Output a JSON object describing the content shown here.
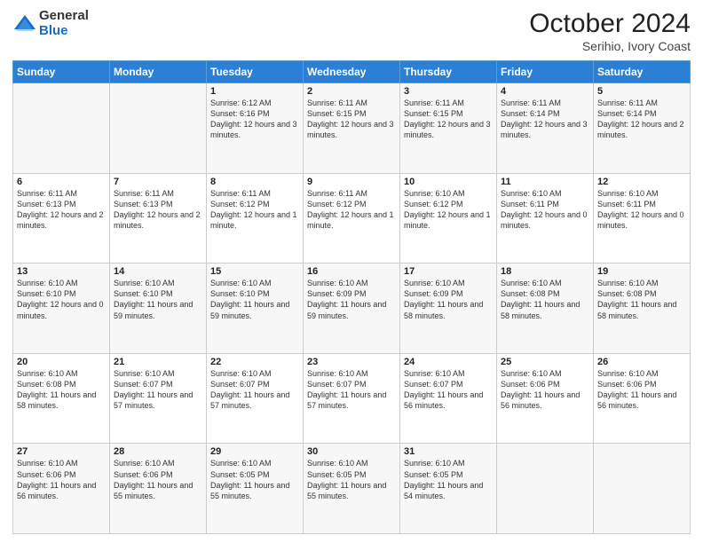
{
  "logo": {
    "general": "General",
    "blue": "Blue"
  },
  "title": "October 2024",
  "location": "Serihio, Ivory Coast",
  "days_of_week": [
    "Sunday",
    "Monday",
    "Tuesday",
    "Wednesday",
    "Thursday",
    "Friday",
    "Saturday"
  ],
  "weeks": [
    [
      {
        "day": "",
        "info": ""
      },
      {
        "day": "",
        "info": ""
      },
      {
        "day": "1",
        "info": "Sunrise: 6:12 AM\nSunset: 6:16 PM\nDaylight: 12 hours and 3 minutes."
      },
      {
        "day": "2",
        "info": "Sunrise: 6:11 AM\nSunset: 6:15 PM\nDaylight: 12 hours and 3 minutes."
      },
      {
        "day": "3",
        "info": "Sunrise: 6:11 AM\nSunset: 6:15 PM\nDaylight: 12 hours and 3 minutes."
      },
      {
        "day": "4",
        "info": "Sunrise: 6:11 AM\nSunset: 6:14 PM\nDaylight: 12 hours and 3 minutes."
      },
      {
        "day": "5",
        "info": "Sunrise: 6:11 AM\nSunset: 6:14 PM\nDaylight: 12 hours and 2 minutes."
      }
    ],
    [
      {
        "day": "6",
        "info": "Sunrise: 6:11 AM\nSunset: 6:13 PM\nDaylight: 12 hours and 2 minutes."
      },
      {
        "day": "7",
        "info": "Sunrise: 6:11 AM\nSunset: 6:13 PM\nDaylight: 12 hours and 2 minutes."
      },
      {
        "day": "8",
        "info": "Sunrise: 6:11 AM\nSunset: 6:12 PM\nDaylight: 12 hours and 1 minute."
      },
      {
        "day": "9",
        "info": "Sunrise: 6:11 AM\nSunset: 6:12 PM\nDaylight: 12 hours and 1 minute."
      },
      {
        "day": "10",
        "info": "Sunrise: 6:10 AM\nSunset: 6:12 PM\nDaylight: 12 hours and 1 minute."
      },
      {
        "day": "11",
        "info": "Sunrise: 6:10 AM\nSunset: 6:11 PM\nDaylight: 12 hours and 0 minutes."
      },
      {
        "day": "12",
        "info": "Sunrise: 6:10 AM\nSunset: 6:11 PM\nDaylight: 12 hours and 0 minutes."
      }
    ],
    [
      {
        "day": "13",
        "info": "Sunrise: 6:10 AM\nSunset: 6:10 PM\nDaylight: 12 hours and 0 minutes."
      },
      {
        "day": "14",
        "info": "Sunrise: 6:10 AM\nSunset: 6:10 PM\nDaylight: 11 hours and 59 minutes."
      },
      {
        "day": "15",
        "info": "Sunrise: 6:10 AM\nSunset: 6:10 PM\nDaylight: 11 hours and 59 minutes."
      },
      {
        "day": "16",
        "info": "Sunrise: 6:10 AM\nSunset: 6:09 PM\nDaylight: 11 hours and 59 minutes."
      },
      {
        "day": "17",
        "info": "Sunrise: 6:10 AM\nSunset: 6:09 PM\nDaylight: 11 hours and 58 minutes."
      },
      {
        "day": "18",
        "info": "Sunrise: 6:10 AM\nSunset: 6:08 PM\nDaylight: 11 hours and 58 minutes."
      },
      {
        "day": "19",
        "info": "Sunrise: 6:10 AM\nSunset: 6:08 PM\nDaylight: 11 hours and 58 minutes."
      }
    ],
    [
      {
        "day": "20",
        "info": "Sunrise: 6:10 AM\nSunset: 6:08 PM\nDaylight: 11 hours and 58 minutes."
      },
      {
        "day": "21",
        "info": "Sunrise: 6:10 AM\nSunset: 6:07 PM\nDaylight: 11 hours and 57 minutes."
      },
      {
        "day": "22",
        "info": "Sunrise: 6:10 AM\nSunset: 6:07 PM\nDaylight: 11 hours and 57 minutes."
      },
      {
        "day": "23",
        "info": "Sunrise: 6:10 AM\nSunset: 6:07 PM\nDaylight: 11 hours and 57 minutes."
      },
      {
        "day": "24",
        "info": "Sunrise: 6:10 AM\nSunset: 6:07 PM\nDaylight: 11 hours and 56 minutes."
      },
      {
        "day": "25",
        "info": "Sunrise: 6:10 AM\nSunset: 6:06 PM\nDaylight: 11 hours and 56 minutes."
      },
      {
        "day": "26",
        "info": "Sunrise: 6:10 AM\nSunset: 6:06 PM\nDaylight: 11 hours and 56 minutes."
      }
    ],
    [
      {
        "day": "27",
        "info": "Sunrise: 6:10 AM\nSunset: 6:06 PM\nDaylight: 11 hours and 56 minutes."
      },
      {
        "day": "28",
        "info": "Sunrise: 6:10 AM\nSunset: 6:06 PM\nDaylight: 11 hours and 55 minutes."
      },
      {
        "day": "29",
        "info": "Sunrise: 6:10 AM\nSunset: 6:05 PM\nDaylight: 11 hours and 55 minutes."
      },
      {
        "day": "30",
        "info": "Sunrise: 6:10 AM\nSunset: 6:05 PM\nDaylight: 11 hours and 55 minutes."
      },
      {
        "day": "31",
        "info": "Sunrise: 6:10 AM\nSunset: 6:05 PM\nDaylight: 11 hours and 54 minutes."
      },
      {
        "day": "",
        "info": ""
      },
      {
        "day": "",
        "info": ""
      }
    ]
  ]
}
